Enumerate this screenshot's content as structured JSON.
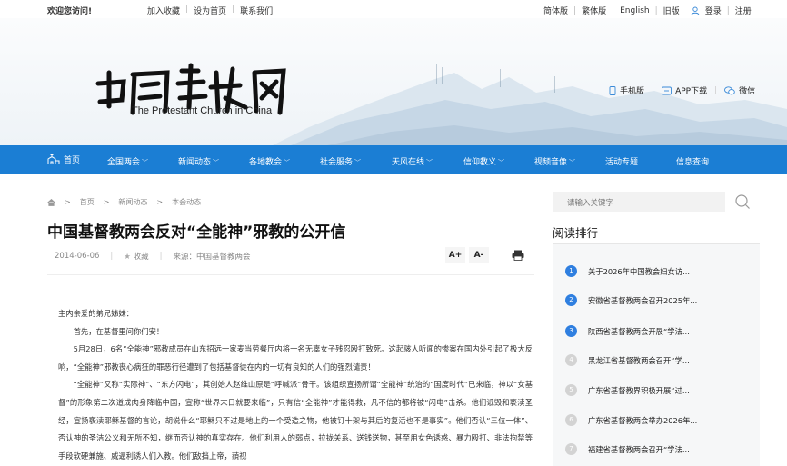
{
  "topbar": {
    "welcome": "欢迎您访问!",
    "left_links": [
      "加入收藏",
      "设为首页",
      "联系我们"
    ],
    "right_links": [
      "简体版",
      "繁体版",
      "English",
      "旧版"
    ],
    "login": "登录",
    "register": "注册"
  },
  "header": {
    "logo_subtitle": "The Protestant Church in China",
    "links": [
      "手机版",
      "APP下载",
      "微信"
    ]
  },
  "nav": {
    "home": "首页",
    "items": [
      "全国两会",
      "新闻动态",
      "各地教会",
      "社会服务",
      "天风在线",
      "信仰教义",
      "视频音像",
      "活动专题",
      "信息查询"
    ],
    "colors": {
      "bar": "#1b7ed4"
    }
  },
  "breadcrumb": [
    "首页",
    "新闻动态",
    "本会动态"
  ],
  "article": {
    "title": "中国基督教两会反对“全能神”邪教的公开信",
    "date": "2014-06-06",
    "favorite": "收藏",
    "source": "来源：中国基督教两会",
    "font_up": "A+",
    "font_down": "A-",
    "paragraphs": [
      "主内亲爱的弟兄姊妹：",
      "首先，在基督里问你们安！",
      "5月28日，6名“全能神”邪教成员在山东招远一家麦当劳餐厅内将一名无辜女子残忍殴打致死。这起骇人听闻的惨案在国内外引起了极大反响，“全能神”邪教丧心病狂的罪恶行径遭到了包括基督徒在内的一切有良知的人们的强烈谴责！",
      "“全能神”又称“实际神”、“东方闪电”，其创始人赵维山原是“呼喊派”骨干。该组织宣扬所谓“全能神”统治的“国度时代”已来临，神以“女基督”的形象第二次道成肉身降临中国，宣称“世界末日就要来临”，只有信“全能神”才能得救，凡不信的都将被“闪电”击杀。他们诋毁和亵渎圣经，宣扬亵渎耶稣基督的言论，胡说什么“耶稣只不过是地上的一个受造之物，他被钉十架与其后的复活也不是事实”。他们否认“三位一体”、否认神的圣洁公义和无所不知，继而否认神的真实存在。他们利用人的弱点，拉拢关系、送钱送物，甚至用女色诱惑、暴力殴打、非法拘禁等手段软硬兼施、威逼利诱人们入教。他们敌挡上帝，藐视"
    ]
  },
  "sidebar": {
    "search_placeholder": "请输入关键字",
    "ranking_title": "阅读排行",
    "ranking": [
      {
        "num": "1",
        "text": "关于2026年中国教会妇女访..."
      },
      {
        "num": "2",
        "text": "安徽省基督教两会召开2025年..."
      },
      {
        "num": "3",
        "text": "陕西省基督教两会开展“学法..."
      },
      {
        "num": "4",
        "text": "黑龙江省基督教两会召开“学..."
      },
      {
        "num": "5",
        "text": "广东省基督教界积极开展“过..."
      },
      {
        "num": "6",
        "text": "广东省基督教两会举办2026年..."
      },
      {
        "num": "7",
        "text": "福建省基督教两会召开“学法..."
      }
    ]
  }
}
